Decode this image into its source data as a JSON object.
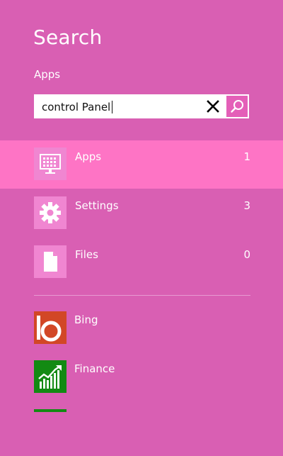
{
  "header": {
    "title": "Search",
    "scope_label": "Apps"
  },
  "search": {
    "value": "control Panel"
  },
  "categories": [
    {
      "label": "Apps",
      "count": "1",
      "icon": "monitor-grid-icon",
      "selected": true
    },
    {
      "label": "Settings",
      "count": "3",
      "icon": "gear-icon",
      "selected": false
    },
    {
      "label": "Files",
      "count": "0",
      "icon": "document-icon",
      "selected": false
    }
  ],
  "apps": [
    {
      "label": "Bing",
      "icon": "bing-logo-icon",
      "color": "#d24726"
    },
    {
      "label": "Finance",
      "icon": "finance-chart-icon",
      "color": "#138a13"
    }
  ],
  "colors": {
    "background": "#d95fb3",
    "selected_row": "#fe74c5",
    "tile": "#f086d1"
  }
}
